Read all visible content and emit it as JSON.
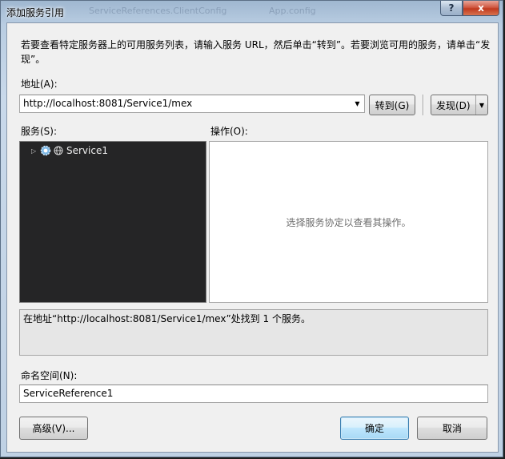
{
  "window": {
    "title": "添加服务引用",
    "ghost_tabs": [
      "ServiceReferences.ClientConfig",
      "App.config"
    ],
    "help_label": "?",
    "close_label": "x"
  },
  "instructions": "若要查看特定服务器上的可用服务列表，请输入服务 URL，然后单击“转到”。若要浏览可用的服务，请单击“发现”。",
  "address": {
    "label": "地址(A):",
    "value": "http://localhost:8081/Service1/mex",
    "go_label": "转到(G)",
    "discover_label": "发现(D)"
  },
  "services": {
    "label": "服务(S):",
    "items": [
      {
        "label": "Service1",
        "icon": "service-gear-icon",
        "icon2": "globe-icon"
      }
    ]
  },
  "operations": {
    "label": "操作(O):",
    "placeholder": "选择服务协定以查看其操作。"
  },
  "status": "在地址“http://localhost:8081/Service1/mex”处找到 1 个服务。",
  "namespace": {
    "label": "命名空间(N):",
    "value": "ServiceReference1"
  },
  "buttons": {
    "advanced": "高级(V)...",
    "ok": "确定",
    "cancel": "取消"
  },
  "colors": {
    "tree_background": "#252526",
    "default_button": "#3c7fb1",
    "close_button": "#c0391f"
  }
}
